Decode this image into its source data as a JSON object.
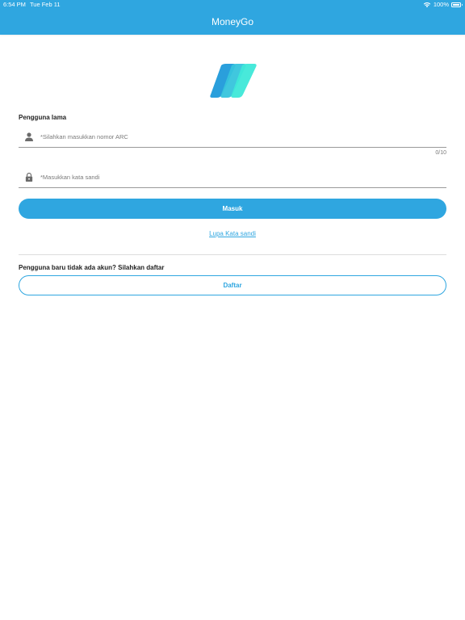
{
  "status_bar": {
    "time": "6:54 PM",
    "date": "Tue Feb 11",
    "battery": "100%",
    "wifi_icon": "wifi-icon",
    "battery_icon": "battery-icon"
  },
  "nav": {
    "title": "MoneyGo"
  },
  "logo": {
    "icon": "moneygo-logo",
    "colors": [
      "#2a9fdc",
      "#36c4dc",
      "#3ee8d8"
    ]
  },
  "login": {
    "section_label": "Pengguna lama",
    "arc_field": {
      "icon": "person-icon",
      "placeholder": "*Silahkan masukkan nomor ARC",
      "value": "",
      "counter": "0/10"
    },
    "password_field": {
      "icon": "lock-icon",
      "placeholder": "*Masukkan kata sandi",
      "value": ""
    },
    "submit_label": "Masuk",
    "forgot_label": "Lupa Kata sandi"
  },
  "register": {
    "prompt": "Pengguna baru tidak ada akun? Silahkan daftar",
    "button_label": "Daftar"
  },
  "colors": {
    "accent": "#2fa6e0",
    "text": "#222222",
    "placeholder": "#7a7a7a",
    "icon": "#6b6b6b"
  }
}
